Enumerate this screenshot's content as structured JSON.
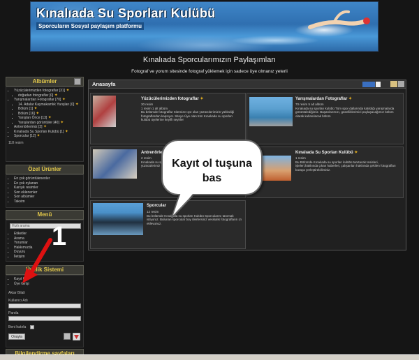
{
  "banner": {
    "title": "Kınalıada Su Sporları Kulübü",
    "subtitle": "Sporcuların Sosyal paylaşım platformu"
  },
  "site": {
    "title": "Kınalıada Sporcularımızın Paylaşımları",
    "note": "Fotograf ve yorum sitesinde fotograf yüklemek için sadece üye olmanız yeterli"
  },
  "sidebar": {
    "albums": {
      "title": "Albümler",
      "items": [
        "Yüzücülerimizden fotograflar [31]",
        "doğadan fotograflar [0]",
        "Yarışmalardan Fotograflar [70]",
        "14. Adalar Kaymakamlık Yarışları [0]",
        "Bölüm [1]",
        "Bölüm [16]",
        "Yarışları Önce [13]",
        "Yarışlardan görüntüler [40]",
        "Antrenörlerimiz [2]",
        "Kınalıada Su Sporları Kulübü [1]",
        "Sporcular [12]"
      ],
      "footer": "118 resim"
    },
    "special": {
      "title": "Özel Ürünler",
      "items": [
        "En çok görüntülenenler",
        "En çok oylanan",
        "Karışık resimler",
        "Son eklenenler",
        "Son albümler",
        "Takvim"
      ]
    },
    "menu": {
      "title": "Menü",
      "search_value": "Hızlı arama",
      "items": [
        "Etiketler",
        "Arama",
        "Yorumlar",
        "Hakkımızda",
        "Duyuru",
        "İletişim"
      ]
    },
    "login": {
      "title": "Üyelik Sistemi",
      "items": [
        "Kayıt Ol",
        "Üye Girişi"
      ],
      "fieldset": "Aktar Bilali",
      "username_label": "Kullanıcı Adı",
      "password_label": "Parola",
      "remember_label": "Beni hatırla",
      "submit_label": "Onayla"
    },
    "info": {
      "title": "Bilgilendirme sayfaları"
    }
  },
  "main": {
    "heading": "Anasayfa",
    "cards": [
      {
        "title": "Yüzücülerimizden fotograflar",
        "meta1": "30 resim",
        "meta2": "1 resim 1 alt albüm",
        "desc": "Bu bölümde fotograflar Sitemize üye olan yüzücülerimizin yüklediği fotograflardan kapsıyor. Siteye Üye olan tüm Kınalıada su sporları kulübü üyelerine keyifli seyirler"
      },
      {
        "title": "Yarışmalardan Fotograflar",
        "meta1": "70 resim 5 alt albüm",
        "meta2": "",
        "desc": "Kınalıada su sporları kulübü Tüm spor dallarında katıldığı yarışmalarda görüntülediğimiz. Başarılarımızı, güzelliklerimizi paylaşacağımız bölüm olarak kullanılacak bölüm"
      },
      {
        "title": "Antrenörlerimiz",
        "meta1": "2 resim",
        "meta2": "Kınalıada su sporları kulübü",
        "desc": "yüzücülerimiz"
      },
      {
        "title": "Kınalıada Su Sporları Kulübü",
        "meta1": "1 resim",
        "meta2": "",
        "desc": "Bu Bölümde Kınalıada su sporları kulübü tanıtacak tesisleri, işleleri,hakkında çıkan haberleri, çalışanları hakkında çekilen fotografları buraya yerleştirebilirsiniz."
      },
      {
        "title": "Sporcular",
        "meta1": "12 resim",
        "meta2": "",
        "desc": "Bu bölümde Kınalıada su sporları Kulübü Sporcularını tanımak istiyoruz. Bulunan sporcular boy ölerlersiniz vesikalık fotografların ızı eklevunuz."
      }
    ]
  },
  "annotation": {
    "bubble": "Kayıt ol tuşuna bas",
    "step": "1"
  },
  "colors": {
    "background": "#151515",
    "accent": "#e2c84a",
    "arrow": "#dd1111"
  }
}
